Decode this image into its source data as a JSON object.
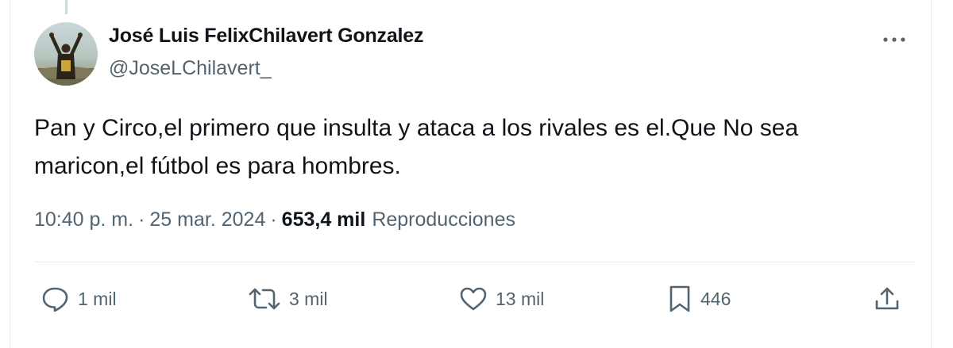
{
  "tweet": {
    "author": {
      "display_name": "José Luis FelixChilavert Gonzalez",
      "handle": "@JoseLChilavert_",
      "avatar_icon": "profile-photo"
    },
    "more_icon": "ellipsis-icon",
    "text_line1": "Pan y Circo,el primero que insulta y ataca a los rivales es el.Que No sea",
    "text_line2": "maricon,el fútbol es para hombres.",
    "time": "10:40 p. m.",
    "separator": "·",
    "date": "25 mar. 2024",
    "views_count": "653,4 mil",
    "views_label": "Reproducciones"
  },
  "actions": {
    "reply": {
      "icon": "reply-icon",
      "count": "1 mil"
    },
    "retweet": {
      "icon": "retweet-icon",
      "count": "3 mil"
    },
    "like": {
      "icon": "heart-icon",
      "count": "13 mil"
    },
    "bookmark": {
      "icon": "bookmark-icon",
      "count": "446"
    },
    "share": {
      "icon": "share-icon"
    }
  },
  "colors": {
    "text_primary": "#0f1419",
    "text_secondary": "#536471",
    "divider": "#e6ebef"
  }
}
